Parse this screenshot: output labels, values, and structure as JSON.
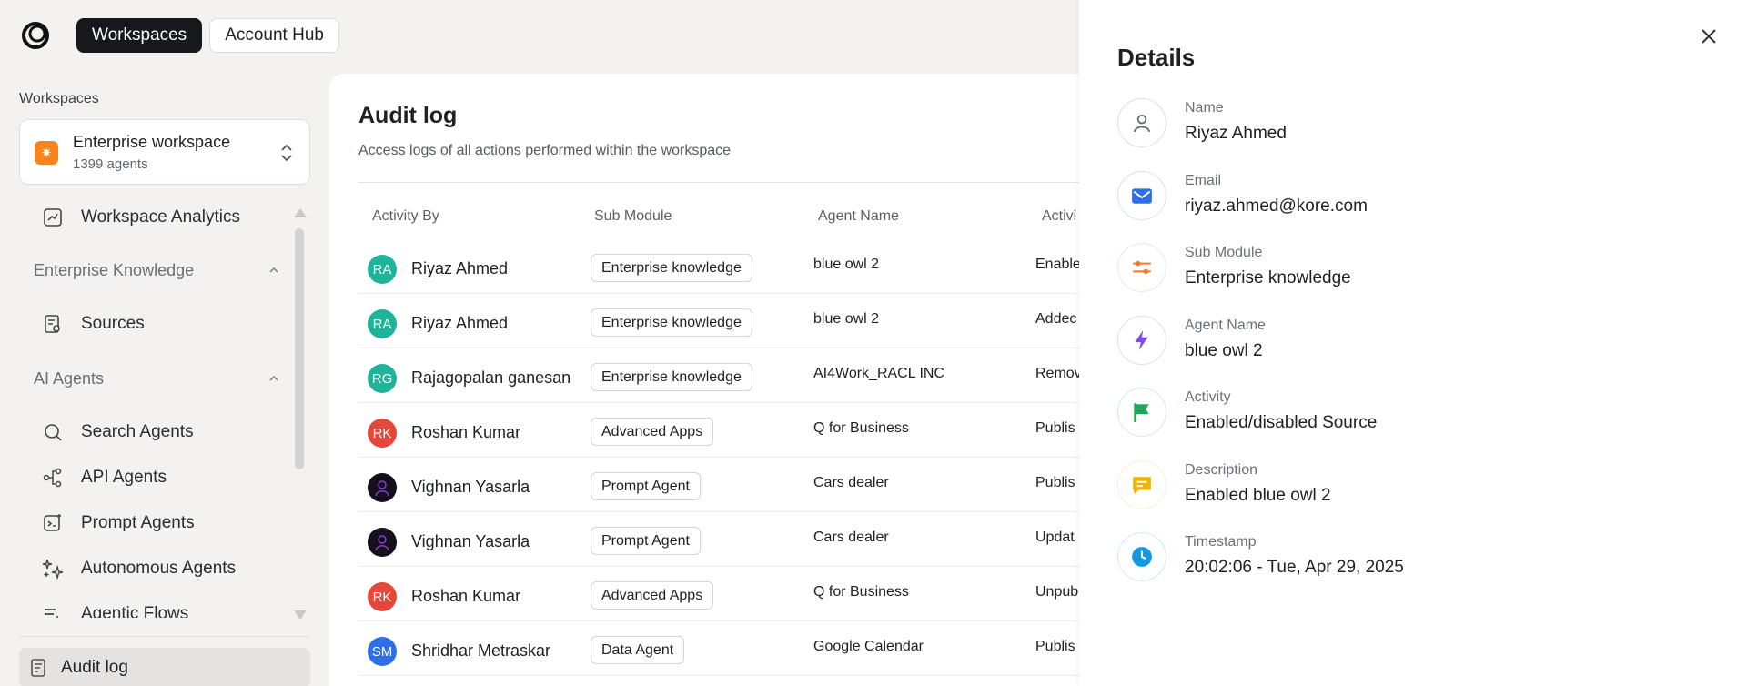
{
  "topbar": {
    "tabs": [
      {
        "label": "Workspaces",
        "active": true
      },
      {
        "label": "Account Hub",
        "active": false
      }
    ]
  },
  "sidebar": {
    "heading": "Workspaces",
    "workspace": {
      "name": "Enterprise workspace",
      "count": "1399 agents",
      "badge_color": "#f7841d"
    },
    "items": [
      {
        "label": "Workspace Analytics",
        "icon": "analytics-icon"
      },
      {
        "label": "Enterprise Knowledge",
        "type": "group"
      },
      {
        "label": "Sources",
        "icon": "sources-icon"
      },
      {
        "label": "AI Agents",
        "type": "group"
      },
      {
        "label": "Search Agents",
        "icon": "search-icon"
      },
      {
        "label": "API Agents",
        "icon": "api-icon"
      },
      {
        "label": "Prompt Agents",
        "icon": "prompt-icon"
      },
      {
        "label": "Autonomous Agents",
        "icon": "sparkle-icon"
      },
      {
        "label": "Agentic Flows",
        "icon": "flows-icon"
      }
    ],
    "active_item": {
      "label": "Audit log",
      "icon": "audit-icon"
    }
  },
  "main": {
    "title": "Audit log",
    "subtitle": "Access logs of all actions performed within the workspace",
    "columns": [
      "Activity By",
      "Sub Module",
      "Agent Name",
      "Activi"
    ],
    "rows": [
      {
        "initials": "RA",
        "name": "Riyaz Ahmed",
        "sub_module": "Enterprise knowledge",
        "agent": "blue owl 2",
        "activity": "Enable",
        "color": "#1fb39a"
      },
      {
        "initials": "RA",
        "name": "Riyaz Ahmed",
        "sub_module": "Enterprise knowledge",
        "agent": "blue owl 2",
        "activity": "Addec",
        "color": "#1fb39a"
      },
      {
        "initials": "RG",
        "name": "Rajagopalan ganesan",
        "sub_module": "Enterprise knowledge",
        "agent": "AI4Work_RACL INC",
        "activity": "Remov",
        "color": "#1fb39a"
      },
      {
        "initials": "RK",
        "name": "Roshan Kumar",
        "sub_module": "Advanced Apps",
        "agent": "Q for Business",
        "activity": "Publis",
        "color": "#e5473b"
      },
      {
        "initials": "",
        "name": "Vighnan Yasarla",
        "sub_module": "Prompt Agent",
        "agent": "Cars dealer",
        "activity": "Publis",
        "color": "#14101c"
      },
      {
        "initials": "",
        "name": "Vighnan Yasarla",
        "sub_module": "Prompt Agent",
        "agent": "Cars dealer",
        "activity": "Updat",
        "color": "#14101c"
      },
      {
        "initials": "RK",
        "name": "Roshan Kumar",
        "sub_module": "Advanced Apps",
        "agent": "Q for Business",
        "activity": "Unpub",
        "color": "#e5473b"
      },
      {
        "initials": "SM",
        "name": "Shridhar Metraskar",
        "sub_module": "Data Agent",
        "agent": "Google Calendar",
        "activity": "Publis",
        "color": "#2f6fe6"
      }
    ]
  },
  "details": {
    "title": "Details",
    "fields": [
      {
        "label": "Name",
        "value": "Riyaz Ahmed",
        "icon": "user-icon",
        "color": "#5f666d"
      },
      {
        "label": "Email",
        "value": "riyaz.ahmed@kore.com",
        "icon": "mail-icon",
        "color": "#2f6fe6"
      },
      {
        "label": "Sub Module",
        "value": "Enterprise knowledge",
        "icon": "sliders-icon",
        "color": "#f07a2a"
      },
      {
        "label": "Agent Name",
        "value": "blue owl 2",
        "icon": "bolt-icon",
        "color": "#7c4dea"
      },
      {
        "label": "Activity",
        "value": "Enabled/disabled Source",
        "icon": "flag-icon",
        "color": "#21a55b"
      },
      {
        "label": "Description",
        "value": "Enabled blue owl 2",
        "icon": "message-icon",
        "color": "#f0b400"
      },
      {
        "label": "Timestamp",
        "value": "20:02:06 - Tue, Apr 29, 2025",
        "icon": "clock-icon",
        "color": "#1598e0"
      }
    ]
  }
}
